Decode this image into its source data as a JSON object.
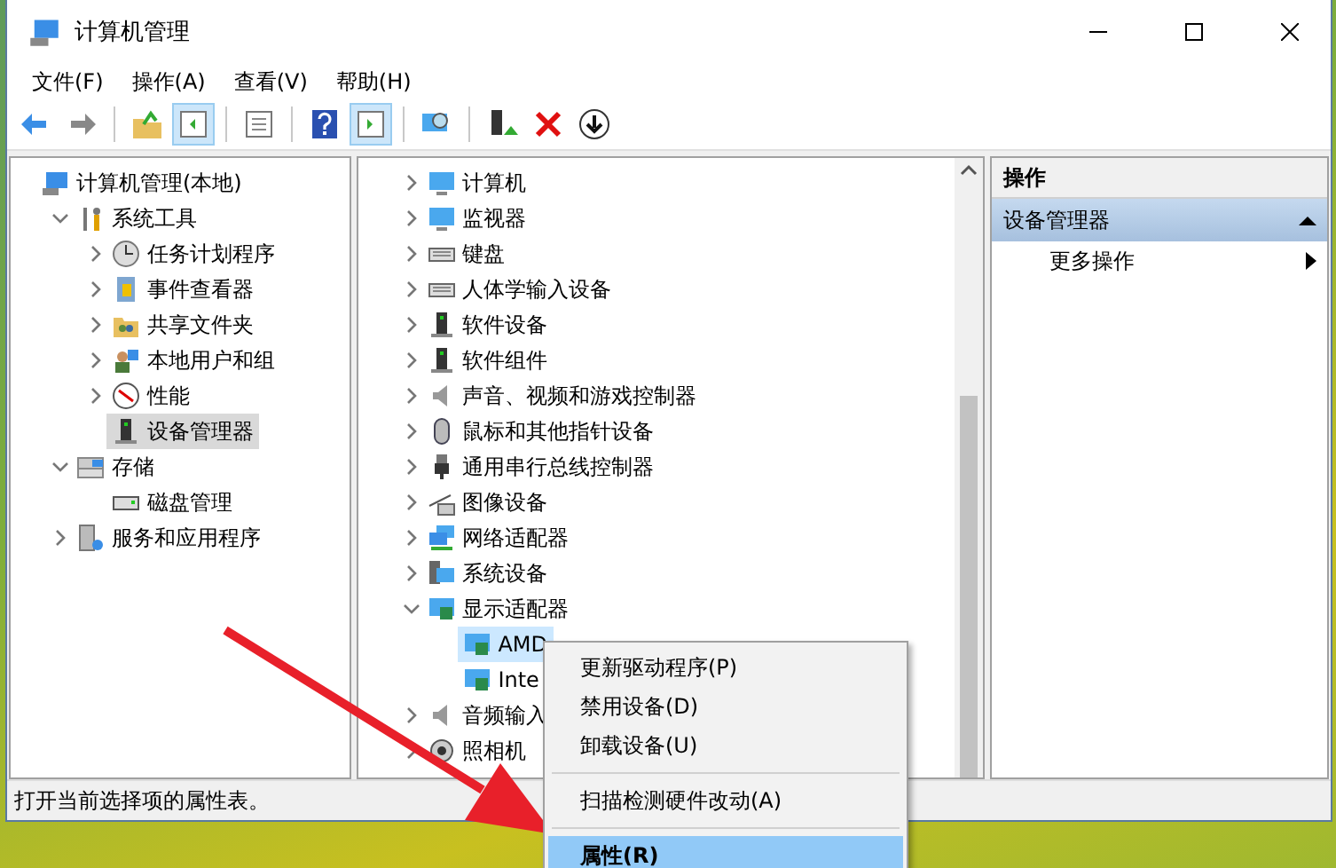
{
  "window": {
    "title": "计算机管理"
  },
  "menu": [
    "文件(F)",
    "操作(A)",
    "查看(V)",
    "帮助(H)"
  ],
  "toolbar": [
    {
      "kind": "back",
      "pressed": false
    },
    {
      "kind": "forward",
      "pressed": false
    },
    {
      "kind": "sep"
    },
    {
      "kind": "up",
      "pressed": false
    },
    {
      "kind": "tree",
      "pressed": true
    },
    {
      "kind": "sep"
    },
    {
      "kind": "props",
      "pressed": false
    },
    {
      "kind": "sep"
    },
    {
      "kind": "help",
      "pressed": false
    },
    {
      "kind": "pane",
      "pressed": true
    },
    {
      "kind": "sep"
    },
    {
      "kind": "scan",
      "pressed": false
    },
    {
      "kind": "sep"
    },
    {
      "kind": "update",
      "pressed": false
    },
    {
      "kind": "remove",
      "pressed": false
    },
    {
      "kind": "down",
      "pressed": false
    }
  ],
  "console_tree": [
    {
      "label": "计算机管理(本地)",
      "kind": "computer",
      "selected": false,
      "children": [
        {
          "label": "系统工具",
          "kind": "tools",
          "expanded": true,
          "selected": false,
          "children": [
            {
              "label": "任务计划程序",
              "kind": "clock",
              "expanded": false,
              "selected": false
            },
            {
              "label": "事件查看器",
              "kind": "log",
              "expanded": false,
              "selected": false
            },
            {
              "label": "共享文件夹",
              "kind": "folder",
              "expanded": false,
              "selected": false
            },
            {
              "label": "本地用户和组",
              "kind": "users",
              "expanded": false,
              "selected": false
            },
            {
              "label": "性能",
              "kind": "gauge",
              "expanded": false,
              "selected": false
            },
            {
              "label": "设备管理器",
              "kind": "device",
              "selected": true
            }
          ]
        },
        {
          "label": "存储",
          "kind": "storage",
          "expanded": true,
          "selected": false,
          "children": [
            {
              "label": "磁盘管理",
              "kind": "disk",
              "selected": false
            }
          ]
        },
        {
          "label": "服务和应用程序",
          "kind": "services",
          "expanded": false,
          "selected": false
        }
      ]
    }
  ],
  "device_tree": [
    {
      "label": "计算机",
      "kind": "monitor",
      "expanded": false,
      "selected": false
    },
    {
      "label": "监视器",
      "kind": "monitor",
      "expanded": false,
      "selected": false
    },
    {
      "label": "键盘",
      "kind": "keyboard",
      "expanded": false,
      "selected": false
    },
    {
      "label": "人体学输入设备",
      "kind": "keyboard",
      "expanded": false,
      "selected": false
    },
    {
      "label": "软件设备",
      "kind": "device",
      "expanded": false,
      "selected": false
    },
    {
      "label": "软件组件",
      "kind": "device",
      "expanded": false,
      "selected": false
    },
    {
      "label": "声音、视频和游戏控制器",
      "kind": "speaker",
      "expanded": false,
      "selected": false
    },
    {
      "label": "鼠标和其他指针设备",
      "kind": "mouse",
      "expanded": false,
      "selected": false
    },
    {
      "label": "通用串行总线控制器",
      "kind": "usb",
      "expanded": false,
      "selected": false
    },
    {
      "label": "图像设备",
      "kind": "camera",
      "expanded": false,
      "selected": false
    },
    {
      "label": "网络适配器",
      "kind": "network",
      "expanded": false,
      "selected": false
    },
    {
      "label": "系统设备",
      "kind": "system",
      "expanded": false,
      "selected": false
    },
    {
      "label": "显示适配器",
      "kind": "display",
      "expanded": true,
      "selected": false,
      "children": [
        {
          "label": "AMD",
          "kind": "display",
          "selected": true
        },
        {
          "label": "Inte",
          "kind": "display",
          "selected": false
        }
      ]
    },
    {
      "label": "音频输入",
      "kind": "speaker",
      "expanded": false,
      "selected": false
    },
    {
      "label": "照相机",
      "kind": "webcam",
      "expanded": false,
      "selected": false
    }
  ],
  "actions": {
    "header": "操作",
    "sections": [
      {
        "title": "设备管理器",
        "expanded": true,
        "items": [
          {
            "label": "更多操作",
            "submenu": true
          }
        ]
      }
    ]
  },
  "context_menu": [
    {
      "kind": "item",
      "label": "更新驱动程序(P)",
      "selected": false,
      "default": false
    },
    {
      "kind": "item",
      "label": "禁用设备(D)",
      "selected": false,
      "default": false
    },
    {
      "kind": "item",
      "label": "卸载设备(U)",
      "selected": false,
      "default": false
    },
    {
      "kind": "separator"
    },
    {
      "kind": "item",
      "label": "扫描检测硬件改动(A)",
      "selected": false,
      "default": false
    },
    {
      "kind": "separator"
    },
    {
      "kind": "item",
      "label": "属性(R)",
      "selected": true,
      "default": true
    }
  ],
  "status_bar": "打开当前选择项的属性表。"
}
